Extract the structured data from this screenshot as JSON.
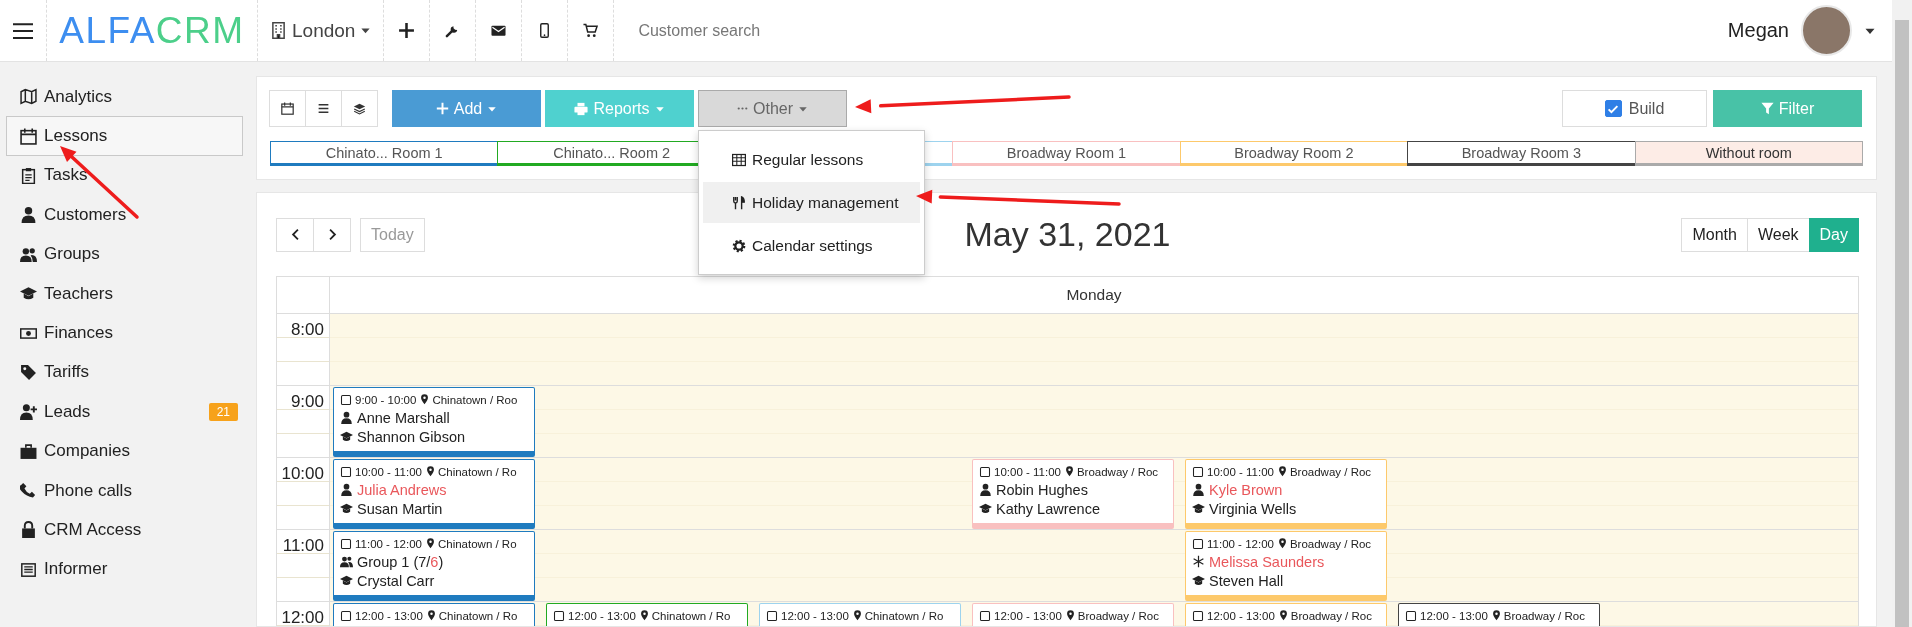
{
  "topbar": {
    "logo": {
      "part_1": "ALFA",
      "part_2": "CRM"
    },
    "branch": "London",
    "search": {
      "placeholder": "Customer search"
    },
    "user": {
      "name": "Megan"
    }
  },
  "sidebar": {
    "items": [
      {
        "label": "Analytics",
        "selected": false
      },
      {
        "label": "Lessons",
        "selected": true
      },
      {
        "label": "Tasks",
        "selected": false
      },
      {
        "label": "Customers",
        "selected": false
      },
      {
        "label": "Groups",
        "selected": false
      },
      {
        "label": "Teachers",
        "selected": false
      },
      {
        "label": "Finances",
        "selected": false
      },
      {
        "label": "Tariffs",
        "selected": false
      },
      {
        "label": "Leads",
        "selected": false,
        "badge": "21"
      },
      {
        "label": "Companies",
        "selected": false
      },
      {
        "label": "Phone calls",
        "selected": false
      },
      {
        "label": "CRM Access",
        "selected": false
      },
      {
        "label": "Informer",
        "selected": false
      }
    ]
  },
  "toolbar": {
    "add": "Add",
    "reports": "Reports",
    "other": "Other",
    "build": {
      "label": "Build",
      "checked": true
    },
    "filter": "Filter"
  },
  "other_menu": {
    "items": [
      {
        "label": "Regular lessons",
        "selected": false
      },
      {
        "label": "Holiday management",
        "selected": true
      },
      {
        "label": "Calendar settings",
        "selected": false
      }
    ]
  },
  "room_tabs": [
    {
      "label": "Chinato... Room 1",
      "color": "#1f7bbf",
      "kind": "room"
    },
    {
      "label": "Chinato... Room 2",
      "color": "#22aa22",
      "kind": "room"
    },
    {
      "color": "#9dd3ee",
      "kind": "room"
    },
    {
      "label": "Broadway Room 1",
      "color": "#f9c0c0",
      "kind": "room"
    },
    {
      "label": "Broadway Room 2",
      "color": "#fdc96b",
      "kind": "room"
    },
    {
      "label": "Broadway Room 3",
      "color": "#444444",
      "kind": "room"
    },
    {
      "label": "Without room",
      "color": "#aaaaaa",
      "kind": "unassigned"
    }
  ],
  "calendar": {
    "today": {
      "label": "Today",
      "disabled": true
    },
    "title": "May 31, 2021",
    "views": [
      {
        "label": "Month",
        "selected": false
      },
      {
        "label": "Week",
        "selected": false
      },
      {
        "label": "Day",
        "selected": true
      }
    ],
    "day_header": "Monday",
    "hours": [
      {
        "label": "8:00",
        "slots": [
          {
            "kind": "empty"
          },
          {
            "kind": "empty"
          },
          {
            "kind": "empty"
          },
          {
            "kind": "empty"
          },
          {
            "kind": "empty"
          },
          {
            "kind": "empty"
          }
        ]
      },
      {
        "label": "9:00",
        "slots": [
          {
            "kind": "lesson",
            "time": "9:00 - 10:00",
            "location": "Chinatown / Roo",
            "color": "#1f7bbf",
            "student": {
              "kind": "customer",
              "parts": [
                {
                  "text": "Anne Marshall",
                  "alert": false
                }
              ]
            },
            "teacher": "Shannon Gibson"
          },
          {
            "kind": "empty"
          },
          {
            "kind": "empty"
          },
          {
            "kind": "empty"
          },
          {
            "kind": "empty"
          },
          {
            "kind": "empty"
          }
        ]
      },
      {
        "label": "10:00",
        "slots": [
          {
            "kind": "lesson",
            "time": "10:00 - 11:00",
            "location": "Chinatown / Ro",
            "color": "#1f7bbf",
            "student": {
              "kind": "customer",
              "parts": [
                {
                  "text": "Julia Andrews",
                  "alert": true
                }
              ]
            },
            "teacher": "Susan Martin"
          },
          {
            "kind": "empty"
          },
          {
            "kind": "empty"
          },
          {
            "kind": "lesson",
            "time": "10:00 - 11:00",
            "location": "Broadway / Roc",
            "color": "#f9c0c0",
            "student": {
              "kind": "customer",
              "parts": [
                {
                  "text": "Robin Hughes",
                  "alert": false
                }
              ]
            },
            "teacher": "Kathy Lawrence"
          },
          {
            "kind": "lesson",
            "time": "10:00 - 11:00",
            "location": "Broadway / Roc",
            "color": "#fdc96b",
            "student": {
              "kind": "customer",
              "parts": [
                {
                  "text": "Kyle Brown",
                  "alert": true
                }
              ]
            },
            "teacher": "Virginia Wells"
          },
          {
            "kind": "empty"
          }
        ]
      },
      {
        "label": "11:00",
        "slots": [
          {
            "kind": "lesson",
            "time": "11:00 - 12:00",
            "location": "Chinatown / Ro",
            "color": "#1f7bbf",
            "student": {
              "kind": "group",
              "parts": [
                {
                  "text": "Group 1 (7/",
                  "alert": false
                },
                {
                  "text": "6",
                  "alert": true
                },
                {
                  "text": ")",
                  "alert": false
                }
              ]
            },
            "teacher": "Crystal Carr"
          },
          {
            "kind": "empty"
          },
          {
            "kind": "empty"
          },
          {
            "kind": "empty"
          },
          {
            "kind": "lesson",
            "time": "11:00 - 12:00",
            "location": "Broadway / Roc",
            "color": "#fdc96b",
            "student": {
              "kind": "lead",
              "parts": [
                {
                  "text": "Melissa Saunders",
                  "alert": true
                }
              ]
            },
            "teacher": "Steven Hall"
          },
          {
            "kind": "empty"
          }
        ]
      },
      {
        "label": "12:00",
        "slots": [
          {
            "kind": "lesson",
            "time": "12:00 - 13:00",
            "location": "Chinatown / Ro",
            "color": "#1f7bbf"
          },
          {
            "kind": "lesson",
            "time": "12:00 - 13:00",
            "location": "Chinatown / Ro",
            "color": "#22aa22"
          },
          {
            "kind": "lesson",
            "time": "12:00 - 13:00",
            "location": "Chinatown / Ro",
            "color": "#9dd3ee"
          },
          {
            "kind": "lesson",
            "time": "12:00 - 13:00",
            "location": "Broadway / Roc",
            "color": "#f9c0c0"
          },
          {
            "kind": "lesson",
            "time": "12:00 - 13:00",
            "location": "Broadway / Roc",
            "color": "#fdc96b"
          },
          {
            "kind": "lesson",
            "time": "12:00 - 13:00",
            "location": "Broadway / Roc",
            "color": "#444444"
          }
        ]
      }
    ]
  }
}
